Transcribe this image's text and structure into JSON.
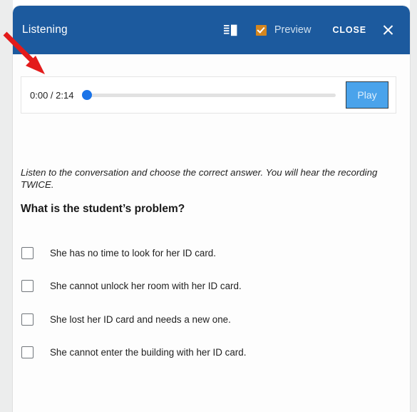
{
  "header": {
    "title": "Listening",
    "compare_icon": "side-by-side-view-icon",
    "preview_label": "Preview",
    "preview_checked": true,
    "close_label": "CLOSE",
    "close_icon": "close-x-icon",
    "background_color": "#1c5a9e"
  },
  "player": {
    "time_display": "0:00 / 2:14",
    "current_time": "0:00",
    "total_time": "2:14",
    "progress_percent": 0,
    "play_label": "Play",
    "thumb_color": "#1a73e8",
    "play_button_color": "#4aa3eb"
  },
  "content": {
    "instruction": "Listen to the conversation and choose the correct answer. You will hear the recording TWICE.",
    "question": "What is the student’s problem?",
    "options": [
      {
        "label": "She has no time to look for her ID card.",
        "checked": false
      },
      {
        "label": "She cannot unlock her room with her ID card.",
        "checked": false
      },
      {
        "label": "She lost her ID card and needs a new one.",
        "checked": false
      },
      {
        "label": "She cannot enter the building with her ID card.",
        "checked": false
      }
    ]
  },
  "annotation": {
    "arrow_color": "#e31b1b",
    "arrow_target": "audio-player"
  }
}
